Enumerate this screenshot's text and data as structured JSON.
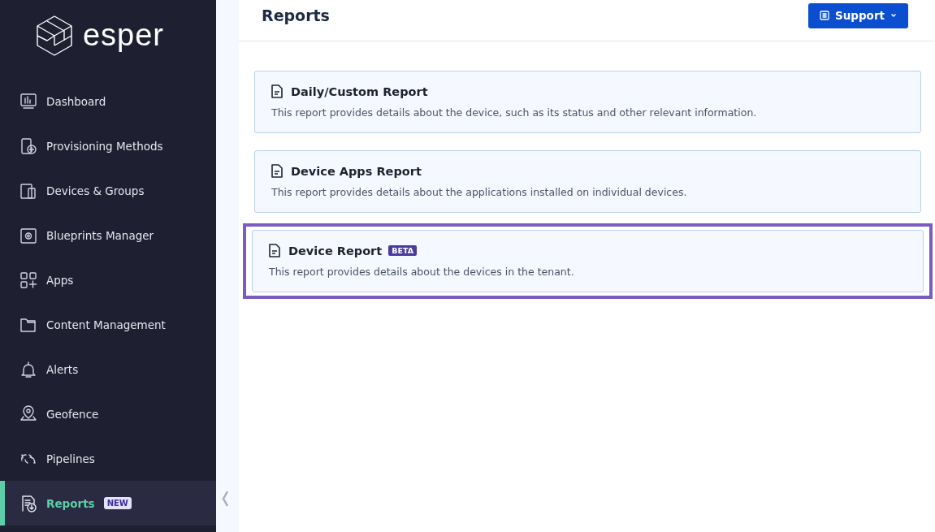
{
  "sidebar": {
    "logo_text": "esper",
    "items": [
      {
        "label": "Dashboard",
        "selected": false
      },
      {
        "label": "Provisioning Methods",
        "selected": false
      },
      {
        "label": "Devices & Groups",
        "selected": false
      },
      {
        "label": "Blueprints Manager",
        "selected": false
      },
      {
        "label": "Apps",
        "selected": false
      },
      {
        "label": "Content Management",
        "selected": false
      },
      {
        "label": "Alerts",
        "selected": false
      },
      {
        "label": "Geofence",
        "selected": false
      },
      {
        "label": "Pipelines",
        "selected": false
      },
      {
        "label": "Reports",
        "selected": true,
        "badge": "NEW"
      }
    ]
  },
  "header": {
    "title": "Reports",
    "support_button": "Support"
  },
  "reports": [
    {
      "title": "Daily/Custom Report",
      "description": "This report provides details about the device, such as its status and other relevant information.",
      "highlighted": false
    },
    {
      "title": "Device Apps Report",
      "description": "This report provides details about the applications installed on individual devices.",
      "highlighted": false
    },
    {
      "title": "Device Report",
      "badge": "BETA",
      "description": "This report provides details about the devices in the tenant.",
      "highlighted": true
    }
  ]
}
